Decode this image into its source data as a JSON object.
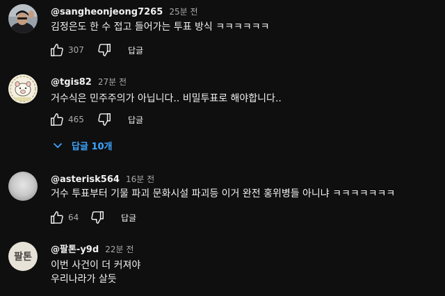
{
  "comments": [
    {
      "author": "@sangheonjeong7265",
      "time": "25분 전",
      "text_lines": [
        "김정은도 한 수 접고 들어가는 투표 방식 ㅋㅋㅋㅋㅋㅋ"
      ],
      "likes": "307",
      "reply_label": "답글",
      "avatar_icon": "waving-person-photo-icon"
    },
    {
      "author": "@tgis82",
      "time": "27분 전",
      "text_lines": [
        "거수식은 민주주의가 아닙니다..  비밀투표로 해야합니다.."
      ],
      "likes": "465",
      "reply_label": "답글",
      "replies_label": "답글 10개",
      "avatar_icon": "cartoon-pig-icon"
    },
    {
      "author": "@asterisk564",
      "time": "16분 전",
      "text_lines": [
        "거수 투표부터 기물 파괴 문화시설 파괴등 이거 완전 홍위병들 아니냐 ㅋㅋㅋㅋㅋㅋㅋ"
      ],
      "likes": "64",
      "reply_label": "답글",
      "avatar_icon": "blurred-photo-icon"
    },
    {
      "author": "@팔톤-y9d",
      "time": "22분 전",
      "avatar_text": "팔톤",
      "text_lines": [
        "이번 사건이 더 커져야",
        "우리나라가 살듯"
      ]
    }
  ],
  "colors": {
    "background": "#0f0f0f",
    "text": "#f1f1f1",
    "secondary": "#aaaaaa",
    "link": "#3ea6ff"
  }
}
